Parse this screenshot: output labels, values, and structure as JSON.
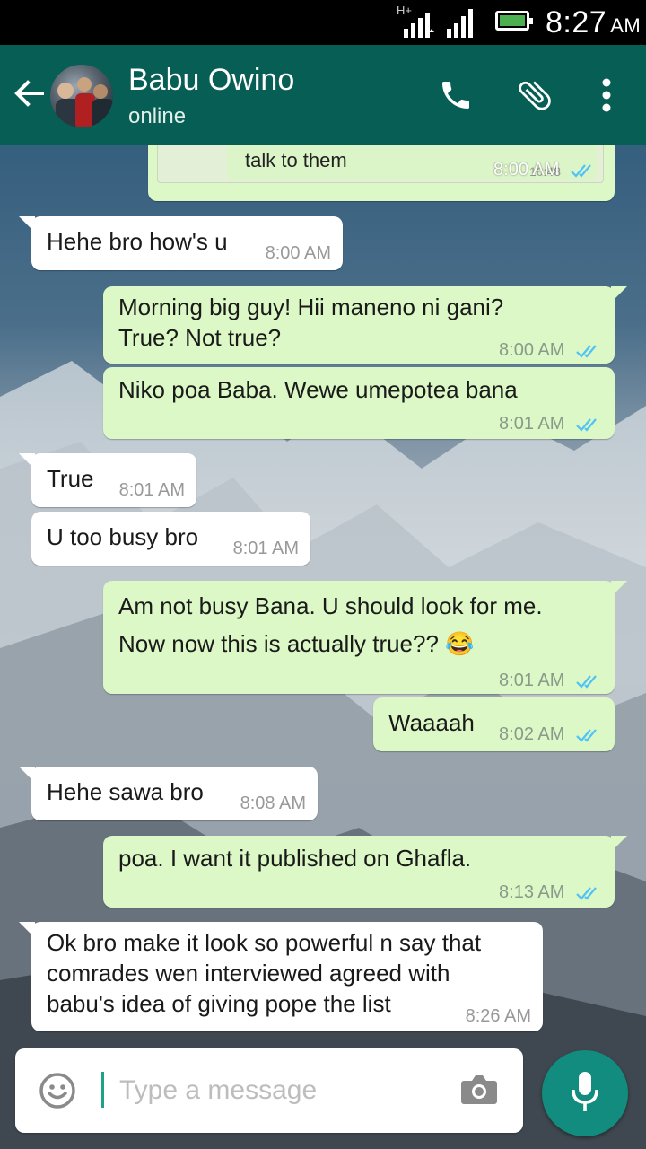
{
  "status_bar": {
    "network": "H+",
    "time": "8:27",
    "ampm": "AM"
  },
  "header": {
    "contact_name": "Babu Owino",
    "contact_status": "online"
  },
  "messages": [
    {
      "direction": "out",
      "text": "talk to them",
      "quoted_time": "10:48",
      "time": "8:00 AM",
      "ticks": "read"
    },
    {
      "direction": "in",
      "text": "Hehe bro how's u",
      "time": "8:00 AM"
    },
    {
      "direction": "out",
      "text": "Morning big guy! Hii maneno ni gani?\nTrue? Not true?",
      "time": "8:00 AM",
      "ticks": "read"
    },
    {
      "direction": "out",
      "text": "Niko poa Baba. Wewe umepotea bana",
      "time": "8:01 AM",
      "ticks": "read"
    },
    {
      "direction": "in",
      "text": "True",
      "time": "8:01 AM"
    },
    {
      "direction": "in",
      "text": "U too busy bro",
      "time": "8:01 AM"
    },
    {
      "direction": "out",
      "text": "Am not busy Bana. U should look for me.\nNow now this is actually true?? 😂",
      "time": "8:01 AM",
      "ticks": "read"
    },
    {
      "direction": "out",
      "text": "Waaaah",
      "time": "8:02 AM",
      "ticks": "read"
    },
    {
      "direction": "in",
      "text": "Hehe sawa bro",
      "time": "8:08 AM"
    },
    {
      "direction": "out",
      "text": "poa. I want it published on Ghafla.",
      "time": "8:13 AM",
      "ticks": "read"
    },
    {
      "direction": "in",
      "text": "Ok bro make it look so powerful n say that\ncomrades wen interviewed agreed with\nbabu's idea of giving pope the list",
      "time": "8:26 AM"
    }
  ],
  "input": {
    "placeholder": "Type a message"
  },
  "icons": {
    "back": "back-arrow-icon",
    "call": "phone-icon",
    "attach": "paperclip-icon",
    "menu": "more-vertical-icon",
    "emoji": "emoji-icon",
    "camera": "camera-icon",
    "mic": "microphone-icon",
    "ticks": "double-check-icon"
  },
  "colors": {
    "header": "#075e54",
    "outgoing_bubble": "#dcf8c6",
    "incoming_bubble": "#ffffff",
    "mic_button": "#128c7e",
    "read_ticks": "#4fc3f7"
  }
}
